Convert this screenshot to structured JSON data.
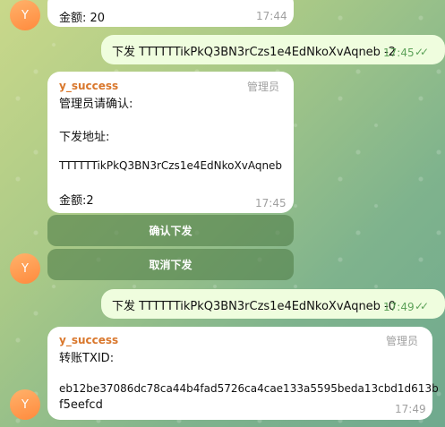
{
  "avatar_letter": "Y",
  "messages": {
    "m1": {
      "text": "金额: 20",
      "time": "17:44"
    },
    "m2": {
      "text": "下发 TTTTTTikPkQ3BN3rCzs1e4EdNkoXvAqneb -2",
      "time": "17:45"
    },
    "m3": {
      "sender": "y_success",
      "role": "管理员",
      "lines": [
        "管理员请确认:",
        "下发地址:",
        "TTTTTTikPkQ3BN3rCzs1e4EdNkoXvAqneb",
        "金额:2"
      ],
      "time": "17:45"
    },
    "m4": {
      "text": "下发 TTTTTTikPkQ3BN3rCzs1e4EdNkoXvAqneb -0",
      "time": "17:49"
    },
    "m5": {
      "sender": "y_success",
      "role": "管理员",
      "lines": [
        "转账TXID:",
        "eb12be37086dc78ca44b4fad5726ca4cae133a5595beda13cbd1d613b",
        "f5eefcd"
      ],
      "time": "17:49"
    }
  },
  "keyboard": {
    "confirm": "确认下发",
    "cancel": "取消下发"
  },
  "colors": {
    "sender": "#d9772c",
    "outgoing_bg": "#effdde",
    "check": "#5ea35a"
  }
}
